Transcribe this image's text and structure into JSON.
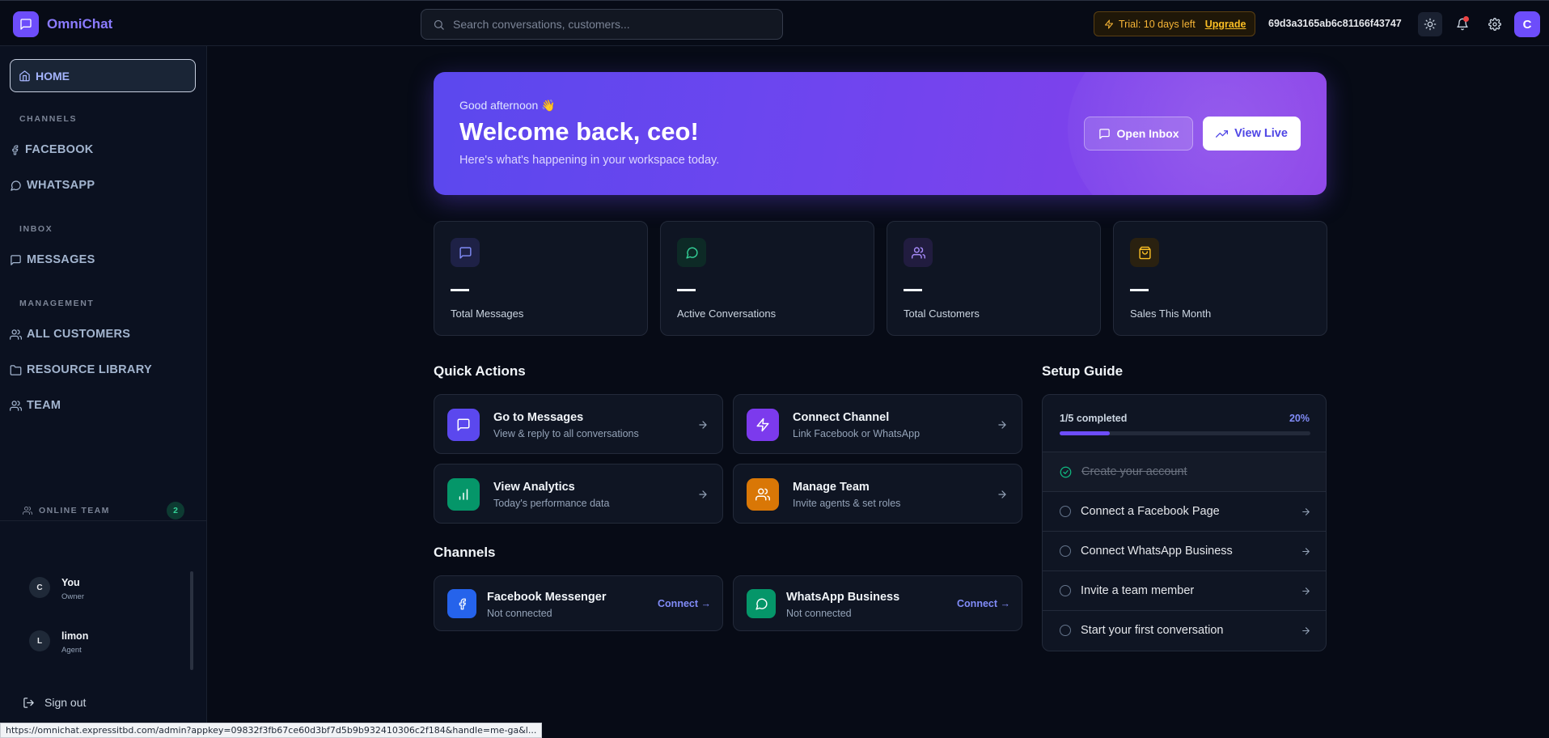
{
  "app": {
    "name": "OmniChat"
  },
  "topbar": {
    "search_placeholder": "Search conversations, customers...",
    "trial_text": "Trial: 10 days left",
    "upgrade_label": "Upgrade",
    "workspace_id": "69d3a3165ab6c81166f43747",
    "avatar_initial": "C"
  },
  "sidebar": {
    "home": "HOME",
    "sections": {
      "channels": "CHANNELS",
      "inbox": "INBOX",
      "management": "MANAGEMENT"
    },
    "items": {
      "facebook": "FACEBOOK",
      "whatsapp": "WHATSAPP",
      "messages": "MESSAGES",
      "all_customers": "ALL CUSTOMERS",
      "resource_library": "RESOURCE LIBRARY",
      "team": "TEAM"
    },
    "online_team": {
      "label": "ONLINE TEAM",
      "count": "2",
      "members": [
        {
          "initial": "C",
          "name": "You",
          "role": "Owner"
        },
        {
          "initial": "L",
          "name": "limon",
          "role": "Agent"
        }
      ]
    },
    "sign_out": "Sign out"
  },
  "hero": {
    "greeting": "Good afternoon 👋",
    "title": "Welcome back, ceo!",
    "subtitle": "Here's what's happening in your workspace today.",
    "open_inbox": "Open Inbox",
    "view_live": "View Live"
  },
  "stats": [
    {
      "label": "Total Messages",
      "value": "—",
      "icon": "message-square-icon",
      "color": "#818cf8"
    },
    {
      "label": "Active Conversations",
      "value": "—",
      "icon": "message-circle-icon",
      "color": "#34d399"
    },
    {
      "label": "Total Customers",
      "value": "—",
      "icon": "users-icon",
      "color": "#a78bfa"
    },
    {
      "label": "Sales This Month",
      "value": "—",
      "icon": "shopping-bag-icon",
      "color": "#fbbf24"
    }
  ],
  "quick_actions": {
    "title": "Quick Actions",
    "items": [
      {
        "title": "Go to Messages",
        "subtitle": "View & reply to all conversations",
        "icon": "message-square-icon",
        "color": "#5b48ee"
      },
      {
        "title": "Connect Channel",
        "subtitle": "Link Facebook or WhatsApp",
        "icon": "zap-icon",
        "color": "#7c3aed"
      },
      {
        "title": "View Analytics",
        "subtitle": "Today's performance data",
        "icon": "bar-chart-icon",
        "color": "#059669"
      },
      {
        "title": "Manage Team",
        "subtitle": "Invite agents & set roles",
        "icon": "users-icon",
        "color": "#d97706"
      }
    ]
  },
  "channels": {
    "title": "Channels",
    "items": [
      {
        "name": "Facebook Messenger",
        "status": "Not connected",
        "action": "Connect →",
        "icon": "facebook-icon",
        "color": "#2563eb"
      },
      {
        "name": "WhatsApp Business",
        "status": "Not connected",
        "action": "Connect →",
        "icon": "whatsapp-icon",
        "color": "#059669"
      }
    ]
  },
  "setup_guide": {
    "title": "Setup Guide",
    "progress_text": "1/5 completed",
    "percent_label": "20%",
    "progress": 0.2,
    "steps": [
      {
        "label": "Create your account",
        "done": true
      },
      {
        "label": "Connect a Facebook Page",
        "done": false
      },
      {
        "label": "Connect WhatsApp Business",
        "done": false
      },
      {
        "label": "Invite a team member",
        "done": false
      },
      {
        "label": "Start your first conversation",
        "done": false
      }
    ]
  },
  "status_bar": {
    "url": "https://omnichat.expressitbd.com/admin?appkey=09832f3fb67ce60d3bf7d5b9b932410306c2f184&handle=me-ga&l..."
  }
}
